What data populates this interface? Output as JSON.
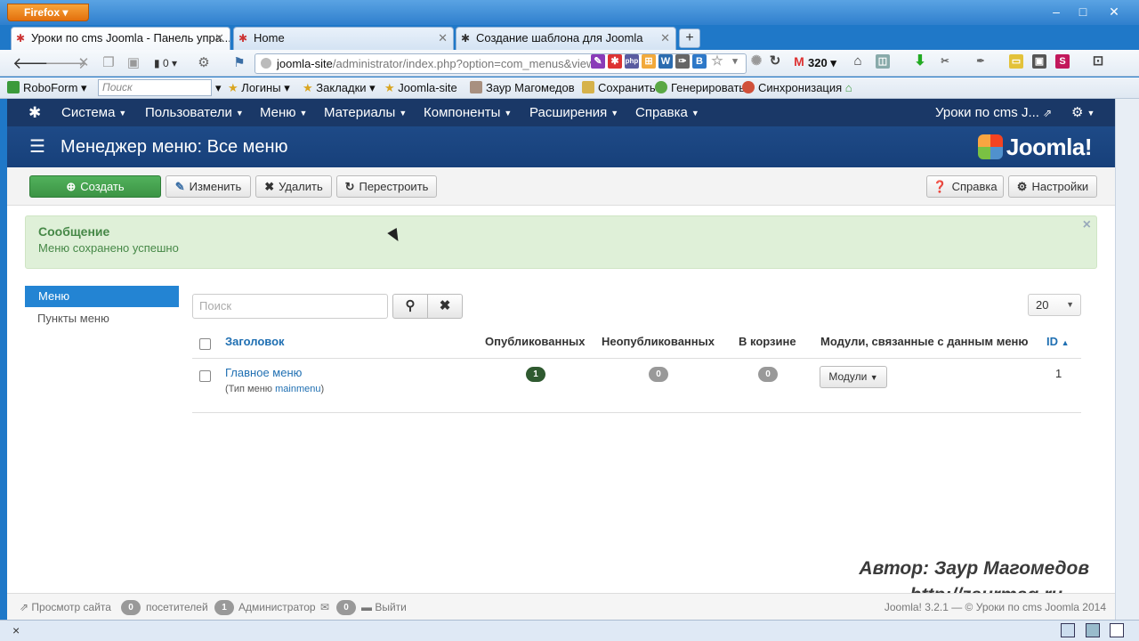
{
  "browser": {
    "menu_label": "Firefox",
    "window_controls": [
      "–",
      "□",
      "✕"
    ],
    "tabs": [
      {
        "title": "Уроки по cms Joomla - Панель упра...",
        "active": true
      },
      {
        "title": "Home",
        "active": false
      },
      {
        "title": "Создание шаблона для Joomla",
        "active": false
      }
    ],
    "new_tab_label": "+",
    "url_host": "joomla-site",
    "url_path": "/administrator/index.php?option=com_menus&view:",
    "gmail_count": "320",
    "bookmarks": {
      "roboform": "RoboForm",
      "search_placeholder": "Поиск",
      "items": [
        "Логины",
        "Закладки",
        "Joomla-site",
        "Заур Магомедов",
        "Сохранить",
        "Генерировать",
        "Синхронизация"
      ]
    },
    "signal_count": "0"
  },
  "joomla": {
    "nav": [
      "Система",
      "Пользователи",
      "Меню",
      "Материалы",
      "Компоненты",
      "Расширения",
      "Справка"
    ],
    "site_link": "Уроки по cms J...",
    "page_title": "Менеджер меню: Все меню",
    "logo_text": "Joomla!",
    "toolbar": {
      "create": "Создать",
      "edit": "Изменить",
      "delete": "Удалить",
      "rebuild": "Перестроить",
      "help": "Справка",
      "options": "Настройки"
    },
    "alert": {
      "heading": "Сообщение",
      "message": "Меню сохранено успешно"
    },
    "sidebar": [
      "Меню",
      "Пункты меню"
    ],
    "search_placeholder": "Поиск",
    "list_limit": "20",
    "table": {
      "headers": {
        "title": "Заголовок",
        "published": "Опубликованных",
        "unpublished": "Неопубликованных",
        "trashed": "В корзине",
        "modules": "Модули, связанные с данным меню",
        "id": "ID"
      },
      "rows": [
        {
          "title": "Главное меню",
          "type_label": "(Тип меню",
          "type_value": "mainmenu",
          "type_close": ")",
          "published": "1",
          "unpublished": "0",
          "trashed": "0",
          "modules_button": "Модули",
          "id": "1"
        }
      ]
    },
    "footer": {
      "view_site": "Просмотр сайта",
      "visitors_count": "0",
      "visitors": "посетителей",
      "admins_count": "1",
      "admins": "Администратор",
      "messages_count": "0",
      "logout": "Выйти",
      "copyright": "Joomla! 3.2.1 — © Уроки по cms Joomla 2014"
    }
  },
  "watermark": {
    "author": "Автор: Заур Магомедов",
    "site": "http://zaurmag.ru"
  }
}
